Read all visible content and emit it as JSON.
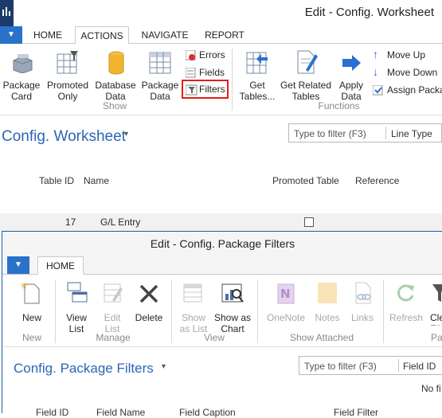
{
  "window": {
    "title": "Edit - Config. Worksheet",
    "tabs": [
      "HOME",
      "ACTIONS",
      "NAVIGATE",
      "REPORT"
    ]
  },
  "ribbon": {
    "package_card": "Package\nCard",
    "promoted_only": "Promoted\nOnly",
    "database_data": "Database\nData",
    "package_data": "Package\nData",
    "errors": "Errors",
    "fields": "Fields",
    "filters": "Filters",
    "show_group": "Show",
    "get_tables": "Get\nTables...",
    "get_related_tables": "Get Related\nTables",
    "apply_data": "Apply\nData",
    "move_up": "Move Up",
    "move_down": "Move Down",
    "assign_package": "Assign Packag",
    "functions_group": "Functions"
  },
  "page": {
    "title": "Config. Worksheet",
    "filter_placeholder": "Type to filter (F3)",
    "filter_field": "Line Type",
    "columns": [
      "Table ID",
      "Name",
      "Promoted Table",
      "Reference"
    ],
    "rows": [
      {
        "table_id": "17",
        "name": "G/L Entry",
        "promoted": false
      }
    ]
  },
  "inner": {
    "title": "Edit - Config. Package Filters",
    "tab": "HOME",
    "new": "New",
    "new_group": "New",
    "view_list": "View\nList",
    "edit_list": "Edit\nList",
    "delete": "Delete",
    "manage_group": "Manage",
    "show_as_list": "Show\nas List",
    "show_as_chart": "Show as\nChart",
    "view_group": "View",
    "onenote": "OneNote",
    "notes": "Notes",
    "links": "Links",
    "show_attached_group": "Show Attached",
    "refresh": "Refresh",
    "clear_filter": "Cle\nFilt",
    "page_group_partial": "Pa",
    "page_title": "Config. Package Filters",
    "filter_placeholder": "Type to filter (F3)",
    "filter_field": "Field ID",
    "no_filter": "No fi",
    "columns": [
      "Field ID",
      "Field Name",
      "Field Caption",
      "Field Filter"
    ]
  },
  "colors": {
    "accent_blue": "#2b66b5",
    "menu_blue": "#2a72c9",
    "highlight_red": "#e0201b"
  }
}
